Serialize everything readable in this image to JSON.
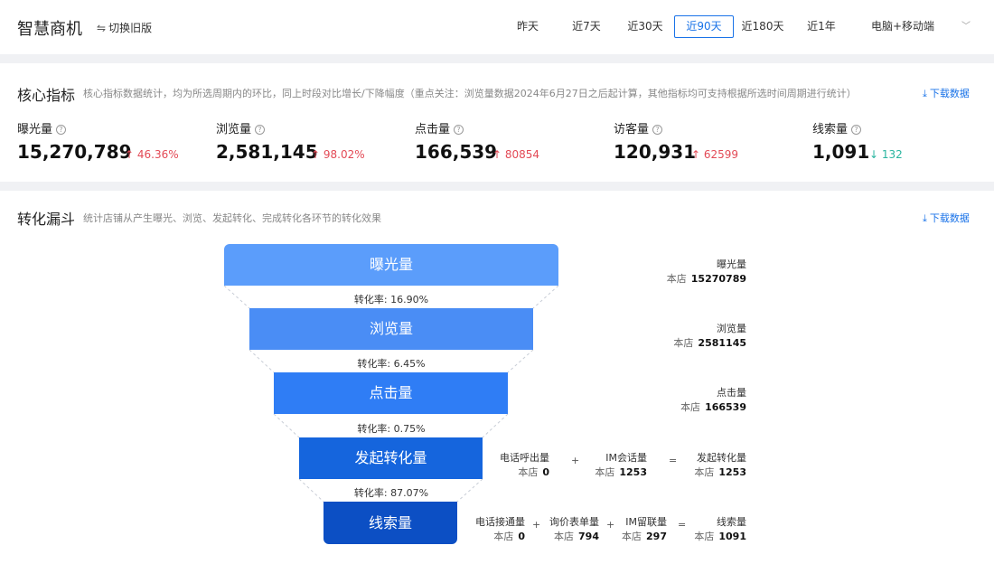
{
  "header": {
    "title": "智慧商机",
    "switch_label": "切换旧版",
    "ranges": [
      "昨天",
      "近7天",
      "近30天",
      "近90天",
      "近180天",
      "近1年"
    ],
    "active_range": "近90天",
    "device": "电脑+移动端"
  },
  "core": {
    "title": "核心指标",
    "desc": "核心指标数据统计，均为所选周期内的环比，同上时段对比增长/下降幅度（重点关注：浏览量数据2024年6月27日之后起计算，其他指标均可支持根据所选时间周期进行统计）",
    "download": "下载数据",
    "metrics": [
      {
        "label": "曝光量",
        "value": "15,270,789",
        "change": "46.36%",
        "dir": "up"
      },
      {
        "label": "浏览量",
        "value": "2,581,145",
        "change": "98.02%",
        "dir": "up"
      },
      {
        "label": "点击量",
        "value": "166,539",
        "change": "80854",
        "dir": "up"
      },
      {
        "label": "访客量",
        "value": "120,931",
        "change": "62599",
        "dir": "up"
      },
      {
        "label": "线索量",
        "value": "1,091",
        "change": "132",
        "dir": "down"
      }
    ]
  },
  "funnel": {
    "title": "转化漏斗",
    "desc": "统计店铺从产生曝光、浏览、发起转化、完成转化各环节的转化效果",
    "download": "下载数据",
    "store_label": "本店",
    "stages": [
      {
        "label": "曝光量",
        "color": "#5b9dfb"
      },
      {
        "label": "浏览量",
        "color": "#4a8df5"
      },
      {
        "label": "点击量",
        "color": "#2f7df5"
      },
      {
        "label": "发起转化量",
        "color": "#1565dd"
      },
      {
        "label": "线索量",
        "color": "#0c4fc4"
      }
    ],
    "rates": [
      "转化率: 16.90%",
      "转化率: 6.45%",
      "转化率: 0.75%",
      "转化率: 87.07%"
    ],
    "side": {
      "exposure": {
        "name": "曝光量",
        "value": "15270789"
      },
      "browse": {
        "name": "浏览量",
        "value": "2581145"
      },
      "click": {
        "name": "点击量",
        "value": "166539"
      },
      "conv_row": [
        {
          "name": "电话呼出量",
          "value": "0"
        },
        {
          "name": "IM会话量",
          "value": "1253"
        },
        {
          "name": "发起转化量",
          "value": "1253"
        }
      ],
      "lead_row": [
        {
          "name": "电话接通量",
          "value": "0"
        },
        {
          "name": "询价表单量",
          "value": "794"
        },
        {
          "name": "IM留联量",
          "value": "297"
        },
        {
          "name": "线索量",
          "value": "1091"
        }
      ]
    },
    "ops": {
      "plus": "+",
      "equals": "="
    }
  }
}
